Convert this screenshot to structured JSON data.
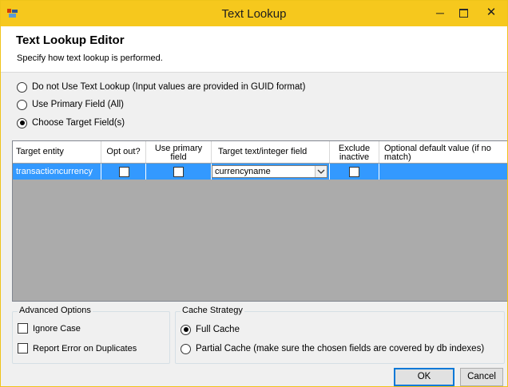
{
  "window": {
    "title": "Text Lookup",
    "minimize": "─",
    "close": "✕"
  },
  "header": {
    "title": "Text Lookup Editor",
    "subtitle": "Specify how text lookup is performed."
  },
  "lookup_mode": {
    "options": [
      {
        "label": "Do not Use Text Lookup (Input values are provided in GUID format)",
        "checked": false
      },
      {
        "label": "Use Primary Field (All)",
        "checked": false
      },
      {
        "label": "Choose Target Field(s)",
        "checked": true
      }
    ]
  },
  "grid": {
    "columns": [
      "Target entity",
      "Opt out?",
      "Use primary field",
      "Target text/integer field",
      "Exclude inactive",
      "Optional default value (if no match)"
    ],
    "rows": [
      {
        "target_entity": "transactioncurrency",
        "opt_out": false,
        "use_primary": false,
        "target_field": "currencyname",
        "exclude_inactive": false,
        "default_value": ""
      }
    ]
  },
  "advanced": {
    "legend": "Advanced Options",
    "ignore_case": {
      "label": "Ignore Case",
      "checked": false
    },
    "report_duplicates": {
      "label": "Report Error on Duplicates",
      "checked": false
    }
  },
  "cache": {
    "legend": "Cache Strategy",
    "full": {
      "label": "Full Cache",
      "checked": true
    },
    "partial": {
      "label": "Partial Cache (make sure the chosen fields are covered by db indexes)",
      "checked": false
    }
  },
  "buttons": {
    "ok": "OK",
    "cancel": "Cancel"
  }
}
